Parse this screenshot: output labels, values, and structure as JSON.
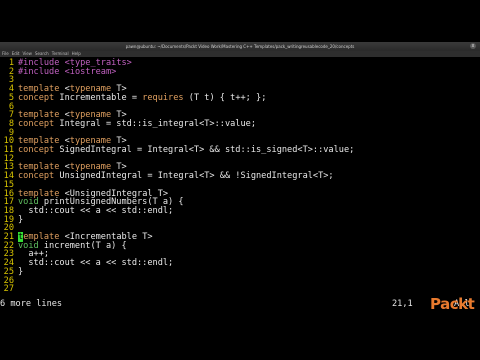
{
  "window": {
    "title": "pawn@ubuntu: ~/Documents/Packt Video Work/Mastering C++ Templates/pack_writingreusablecode_20/concepts",
    "menu": [
      "File",
      "Edit",
      "View",
      "Search",
      "Terminal",
      "Help"
    ],
    "close_glyph": "x"
  },
  "editor": {
    "lines": [
      {
        "n": "1",
        "text": "#include <type_traits>"
      },
      {
        "n": "2",
        "text": "#include <iostream>"
      },
      {
        "n": "3",
        "text": ""
      },
      {
        "n": "4",
        "text": "template <typename T>"
      },
      {
        "n": "5",
        "text": "concept Incrementable = requires (T t) { t++; };"
      },
      {
        "n": "6",
        "text": ""
      },
      {
        "n": "7",
        "text": "template <typename T>"
      },
      {
        "n": "8",
        "text": "concept Integral = std::is_integral<T>::value;"
      },
      {
        "n": "9",
        "text": ""
      },
      {
        "n": "10",
        "text": "template <typename T>"
      },
      {
        "n": "11",
        "text": "concept SignedIntegral = Integral<T> && std::is_signed<T>::value;"
      },
      {
        "n": "12",
        "text": ""
      },
      {
        "n": "13",
        "text": "template <typename T>"
      },
      {
        "n": "14",
        "text": "concept UnsignedIntegral = Integral<T> && !SignedIntegral<T>;"
      },
      {
        "n": "15",
        "text": ""
      },
      {
        "n": "16",
        "text": "template <UnsignedIntegral T>"
      },
      {
        "n": "17",
        "text": "void printUnsignedNumbers(T a) {"
      },
      {
        "n": "18",
        "text": "  std::cout << a << std::endl;"
      },
      {
        "n": "19",
        "text": "}"
      },
      {
        "n": "20",
        "text": ""
      },
      {
        "n": "21",
        "text": "template <Incrementable T>",
        "cursor": true
      },
      {
        "n": "22",
        "text": "void increment(T a) {"
      },
      {
        "n": "23",
        "text": "  a++;"
      },
      {
        "n": "24",
        "text": "  std::cout << a << std::endl;"
      },
      {
        "n": "25",
        "text": "}"
      },
      {
        "n": "26",
        "text": ""
      },
      {
        "n": "27",
        "text": ""
      }
    ]
  },
  "status": {
    "message": "6 more lines",
    "position": "21,1",
    "scroll": "All"
  },
  "brand": {
    "logo_text": "Packt",
    "color": "#e87a2e"
  }
}
